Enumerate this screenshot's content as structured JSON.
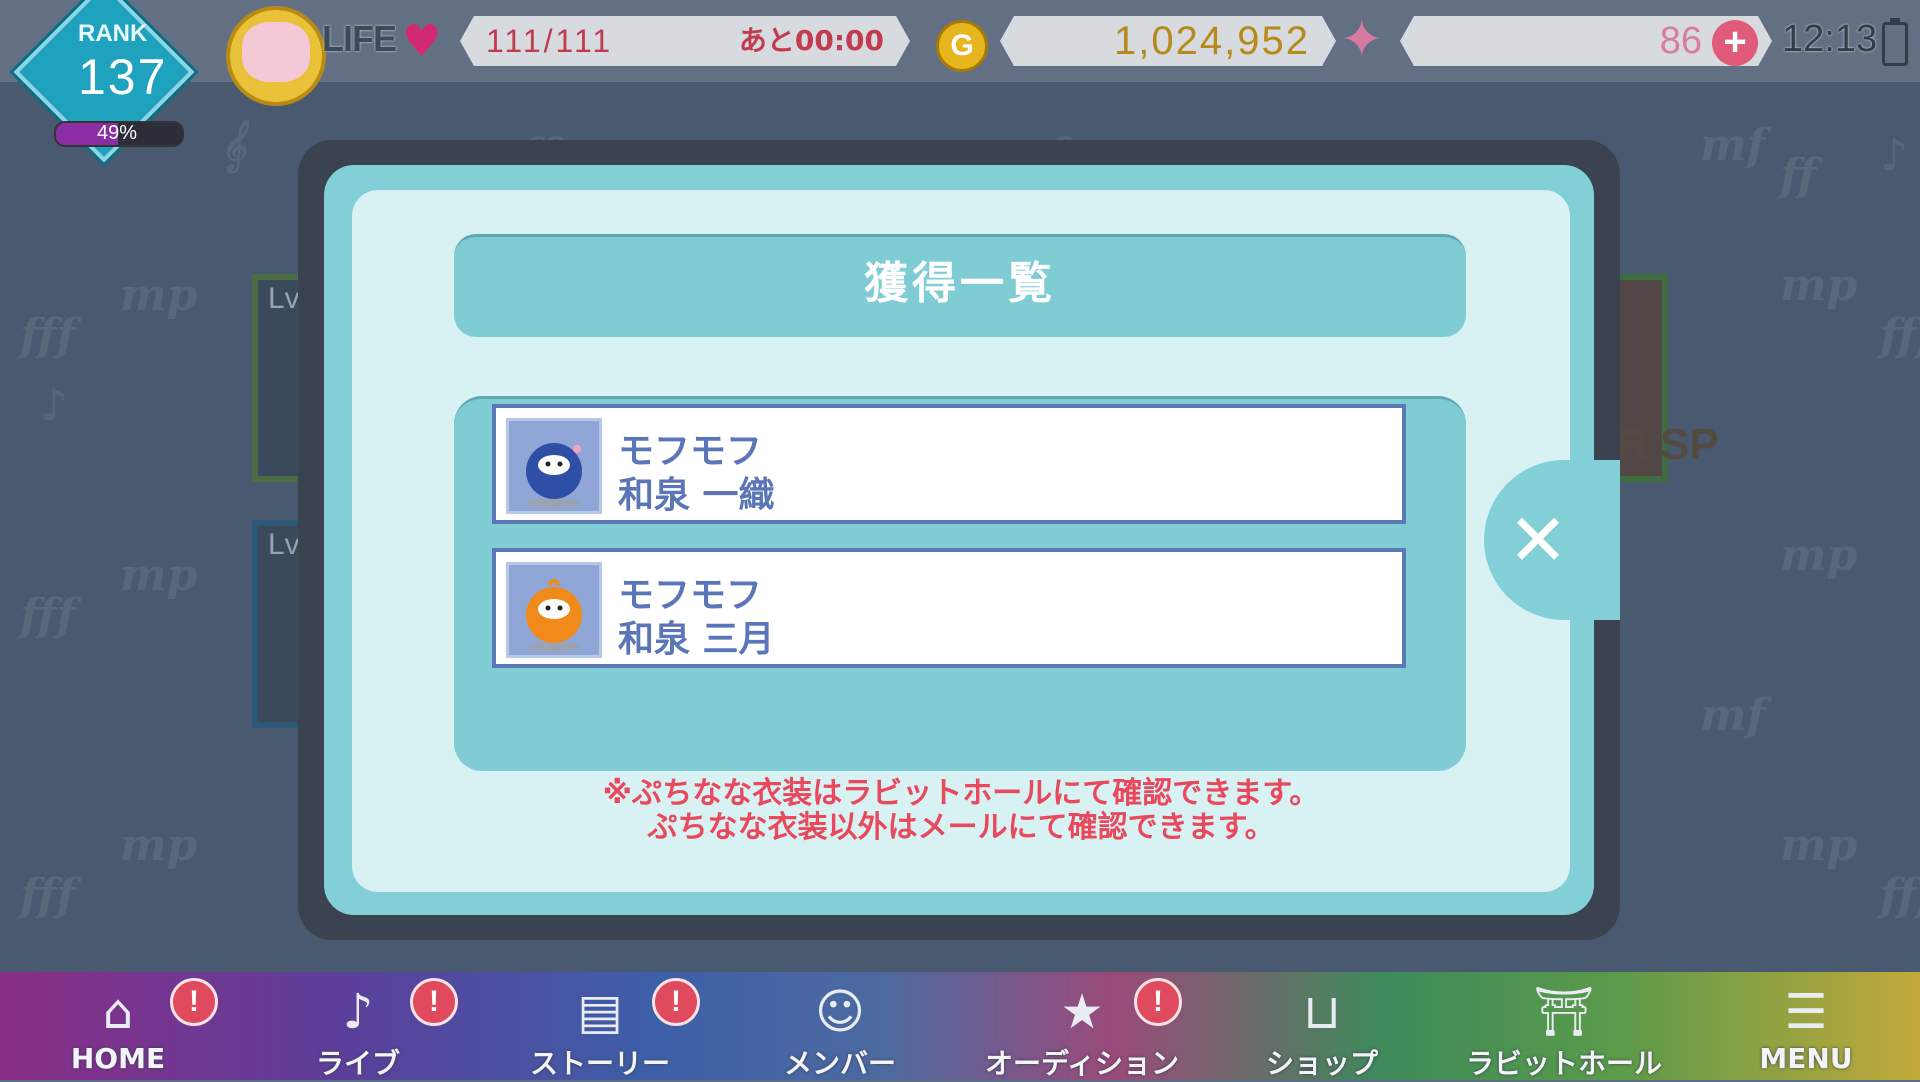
{
  "header": {
    "rank_label": "RANK",
    "rank_value": "137",
    "rank_progress_text": "49%",
    "rank_progress_fraction": 0.49,
    "life_label": "LIFE",
    "life_value": "111/111",
    "life_timer": "あと00:00",
    "coin_symbol": "G",
    "money_value": "1,024,952",
    "star_value": "86",
    "plus_symbol": "+",
    "clock": "12:13"
  },
  "background": {
    "card_level_label": "Lv.",
    "rarity_tag": "R SP",
    "notes": [
      "mp",
      "fff",
      "mf",
      "ff",
      "n",
      "♪",
      "♩",
      "𝄞",
      "𝄢"
    ]
  },
  "modal": {
    "title": "獲得一覧",
    "items": [
      {
        "name": "モフモフ",
        "owner": "和泉 一織",
        "thumb_color": "#2f4fa6"
      },
      {
        "name": "モフモフ",
        "owner": "和泉 三月",
        "thumb_color": "#f08a1a"
      }
    ],
    "close_symbol": "✕",
    "note_line1": "※ぷちなな衣装はラビットホールにて確認できます。",
    "note_line2": "ぷちなな衣装以外はメールにて確認できます。"
  },
  "nav": [
    {
      "label": "HOME",
      "icon": "home-icon",
      "glyph": "⌂",
      "alert": true
    },
    {
      "label": "ライブ",
      "icon": "music-note-icon",
      "glyph": "♪",
      "alert": true
    },
    {
      "label": "ストーリー",
      "icon": "book-icon",
      "glyph": "▤",
      "alert": true
    },
    {
      "label": "メンバー",
      "icon": "member-icon",
      "glyph": "☺",
      "alert": false
    },
    {
      "label": "オーディション",
      "icon": "star-card-icon",
      "glyph": "★",
      "alert": true
    },
    {
      "label": "ショップ",
      "icon": "basket-icon",
      "glyph": "⊔",
      "alert": false
    },
    {
      "label": "ラビットホール",
      "icon": "gate-icon",
      "glyph": "⛩",
      "alert": false
    },
    {
      "label": "MENU",
      "icon": "menu-icon",
      "glyph": "☰",
      "alert": false
    }
  ],
  "alert_symbol": "!",
  "colors": {
    "modal_outer": "#82cfd7",
    "modal_inner": "#d8f2f4",
    "item_text": "#5b76b8",
    "note_text": "#e8495d",
    "rank_bar": "#8c2ea3"
  }
}
